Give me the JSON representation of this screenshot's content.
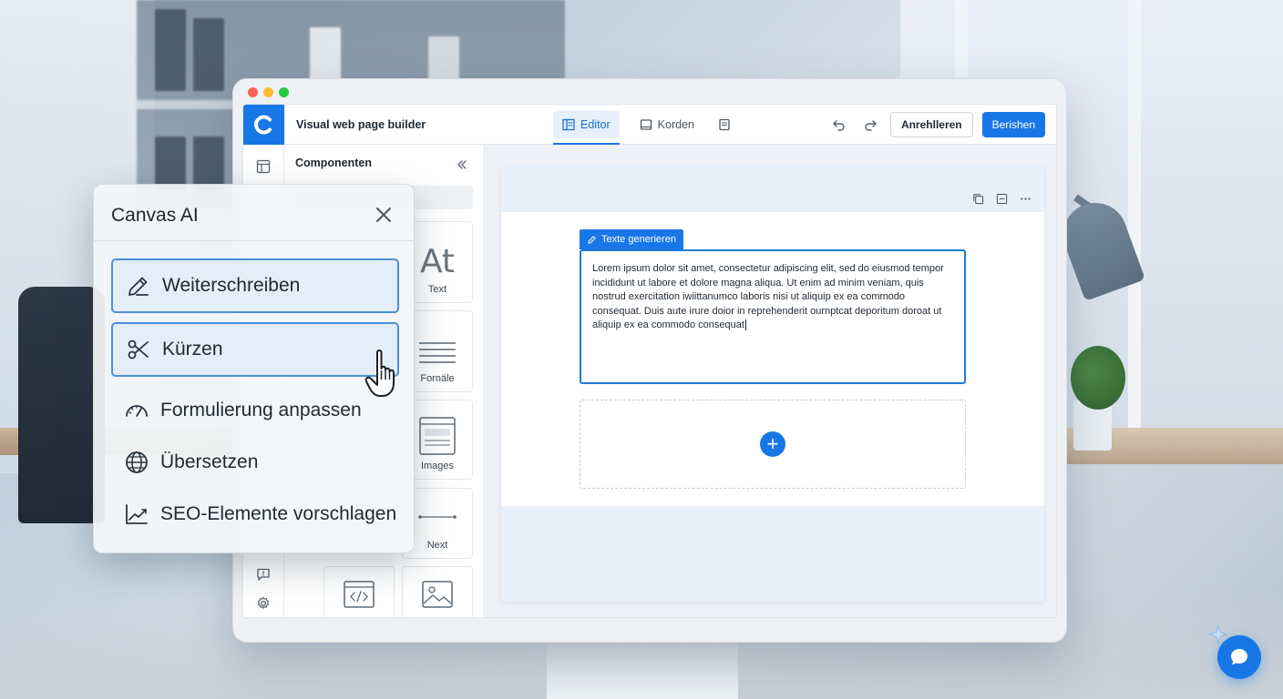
{
  "app": {
    "title": "Visual web page builder",
    "logo_letter": "C",
    "tabs": [
      {
        "label": "Editor",
        "icon": "editor-icon",
        "active": true
      },
      {
        "label": "Korden",
        "icon": "book-icon",
        "active": false
      },
      {
        "label": "",
        "icon": "document-icon",
        "active": false
      }
    ],
    "actions": {
      "secondary_label": "Anrehlleren",
      "primary_label": "Berishen"
    }
  },
  "components_panel": {
    "title": "Componenten",
    "items": [
      {
        "label": "Text",
        "icon": "text-at-icon"
      },
      {
        "label": "Fornäle",
        "icon": "lines-icon"
      },
      {
        "label": "Images",
        "icon": "browser-window-icon"
      },
      {
        "label": "Next",
        "icon": "divider-line-icon"
      },
      {
        "label": "",
        "icon": "code-icon"
      },
      {
        "label": "",
        "icon": "image-icon"
      }
    ]
  },
  "canvas": {
    "badge_label": "Texte generieren",
    "body_text": "Lorem ipsum dolor sit amet, consectetur adipiscing elit, sed do eiusmod tempor incididunt ut labore et dolore magna aliqua. Ut enim ad minim veniam, quis nostrud exercitation iwiittanumco laboris nisi ut aliquip ex ea commodo consequat. Duis aute irure doior in reprehenderit ournptcat deporitum doroat ut aliquip ex ea commodo consequat",
    "add_symbol": "+"
  },
  "ai_panel": {
    "title": "Canvas AI",
    "items": [
      {
        "label": "Weiterschreiben",
        "icon": "pencil-icon",
        "selected": true
      },
      {
        "label": "Kürzen",
        "icon": "scissors-icon",
        "selected": true
      },
      {
        "label": "Formulierung anpassen",
        "icon": "speedometer-icon",
        "selected": false
      },
      {
        "label": "Übersetzen",
        "icon": "globe-icon",
        "selected": false
      },
      {
        "label": "SEO-Elemente vorschlagen",
        "icon": "trend-chart-icon",
        "selected": false
      }
    ]
  },
  "colors": {
    "accent": "#1877e6",
    "selection_fill": "#e3eef9",
    "selection_border": "#4b8fd9"
  }
}
